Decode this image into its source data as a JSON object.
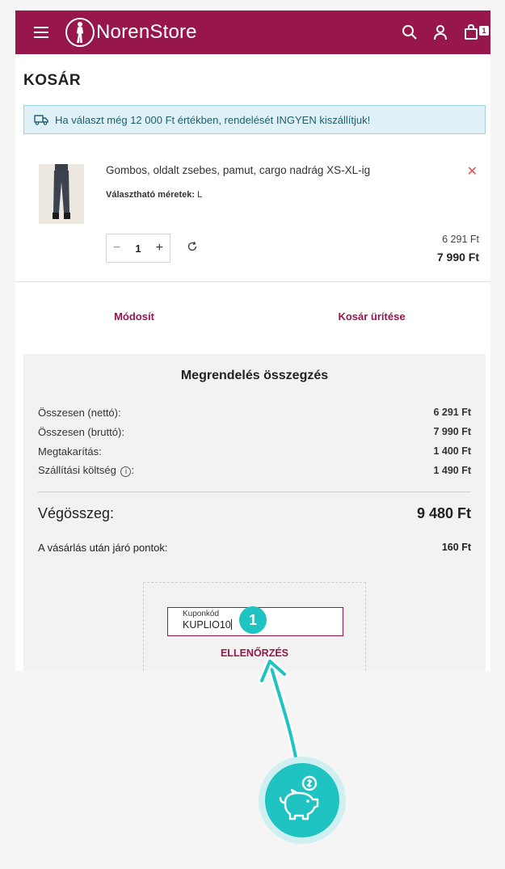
{
  "header": {
    "logo_text": "NorenStore",
    "cart_count": "1",
    "brand_color": "#97174a"
  },
  "page_title": "KOSÁR",
  "notice": "Ha választ még 12 000 Ft értékben, rendelését INGYEN kiszállítjuk!",
  "product": {
    "name": "Gombos, oldalt zsebes, pamut, cargo nadrág XS-XL-ig",
    "size_label": "Választható méretek:",
    "size_value": "L",
    "quantity": "1",
    "price_net": "6 291 Ft",
    "price_gross": "7 990 Ft"
  },
  "actions": {
    "modify": "Módosít",
    "empty_cart": "Kosár ürítése"
  },
  "summary": {
    "title": "Megrendelés összegzés",
    "rows": [
      {
        "label": "Összesen (nettó):",
        "value": "6 291 Ft"
      },
      {
        "label": "Összesen (bruttó):",
        "value": "7 990 Ft"
      },
      {
        "label": "Megtakarítás:",
        "value": "1 400 Ft"
      },
      {
        "label": "Szállítási költség",
        "value": "1 490 Ft"
      }
    ],
    "info_glyph": "i",
    "colon": ":",
    "total_label": "Végösszeg:",
    "total_value": "9 480 Ft",
    "points_label": "A vásárlás után járó pontok:",
    "points_value": "160 Ft"
  },
  "coupon": {
    "label": "Kuponkód",
    "value": "KUPLIO10",
    "check_button": "ELLENŐRZÉS"
  },
  "annotation": {
    "step": "1",
    "accent_color": "#1ec3c2"
  }
}
